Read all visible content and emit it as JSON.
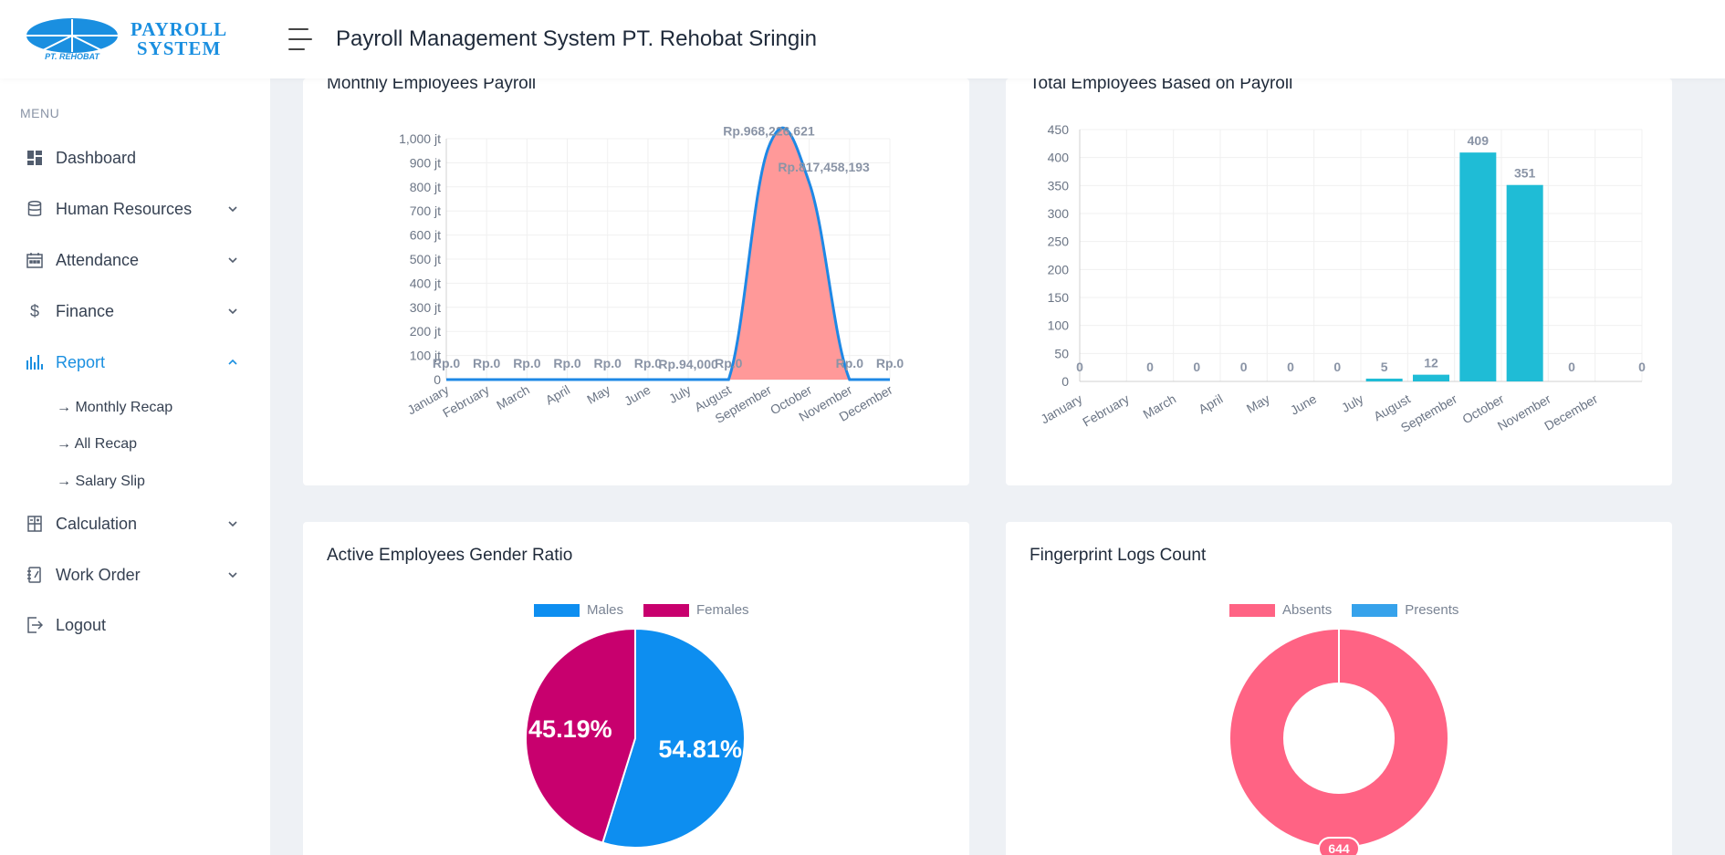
{
  "header": {
    "logo_line1": "PAYROLL",
    "logo_line2": "SYSTEM",
    "logo_arc_text": "PT. REHOBAT",
    "title": "Payroll Management System PT. Rehobat Sringin"
  },
  "sidebar": {
    "heading": "MENU",
    "items": [
      {
        "label": "Dashboard",
        "icon": "dashboard-icon",
        "chevron": ""
      },
      {
        "label": "Human Resources",
        "icon": "database-icon",
        "chevron": "down"
      },
      {
        "label": "Attendance",
        "icon": "calendar-icon",
        "chevron": "down"
      },
      {
        "label": "Finance",
        "icon": "dollar-icon",
        "chevron": "down"
      },
      {
        "label": "Report",
        "icon": "bar-chart-icon",
        "chevron": "up"
      },
      {
        "label": "Calculation",
        "icon": "calculator-icon",
        "chevron": "down"
      },
      {
        "label": "Work Order",
        "icon": "notebook-icon",
        "chevron": "down"
      },
      {
        "label": "Logout",
        "icon": "logout-icon",
        "chevron": ""
      }
    ],
    "report_sub_items": [
      "→ Monthly Recap",
      "→ All Recap",
      "→ Salary Slip"
    ]
  },
  "colors": {
    "accent": "#1a8fe0",
    "payroll_fill": "#ff9999",
    "payroll_line": "#1e88e5",
    "bar": "#1fbcd6",
    "males": "#0d8ef0",
    "females": "#c8006e",
    "absents": "#ff6384",
    "presents": "#36a2eb"
  },
  "cards": {
    "payroll": {
      "title": "Monthly Employees Payroll"
    },
    "employees": {
      "title": "Total Employees Based on Payroll"
    },
    "gender": {
      "title": "Active Employees Gender Ratio"
    },
    "fingerprint": {
      "title": "Fingerprint Logs Count"
    }
  },
  "chart_data": [
    {
      "id": "payroll",
      "type": "area",
      "categories": [
        "January",
        "February",
        "March",
        "April",
        "May",
        "June",
        "July",
        "August",
        "September",
        "October",
        "November",
        "December"
      ],
      "values": [
        0,
        0,
        0,
        0,
        0,
        0,
        94000,
        0,
        968226621,
        817458193,
        0,
        0
      ],
      "data_labels": [
        "Rp.0",
        "Rp.0",
        "Rp.0",
        "Rp.0",
        "Rp.0",
        "Rp.0",
        "Rp.94,000",
        "Rp.0",
        "Rp.968,226,621",
        "Rp.817,458,193",
        "Rp.0",
        "Rp.0"
      ],
      "y_ticks": [
        "0",
        "100 jt",
        "200 jt",
        "300 jt",
        "400 jt",
        "500 jt",
        "600 jt",
        "700 jt",
        "800 jt",
        "900 jt",
        "1,000 jt"
      ],
      "ylim": [
        0,
        1000000000
      ],
      "title": "Monthly Employees Payroll",
      "grid": true
    },
    {
      "id": "employees",
      "type": "bar",
      "categories": [
        "January",
        "February",
        "March",
        "April",
        "May",
        "June",
        "July",
        "August",
        "September",
        "October",
        "November",
        "December"
      ],
      "values": [
        0,
        0,
        0,
        0,
        0,
        0,
        5,
        12,
        409,
        351,
        0,
        0
      ],
      "y_ticks": [
        0,
        50,
        100,
        150,
        200,
        250,
        300,
        350,
        400,
        450
      ],
      "ylim": [
        0,
        450
      ],
      "title": "Total Employees Based on Payroll",
      "grid": true
    },
    {
      "id": "gender",
      "type": "pie",
      "labels": [
        "Males",
        "Females"
      ],
      "values": [
        54.81,
        45.19
      ],
      "value_labels": [
        "54.81%",
        "45.19%"
      ],
      "title": "Active Employees Gender Ratio",
      "legend": "top"
    },
    {
      "id": "fingerprint",
      "type": "pie",
      "donut": true,
      "labels": [
        "Absents",
        "Presents"
      ],
      "values": [
        644,
        0
      ],
      "value_labels": [
        "644"
      ],
      "title": "Fingerprint Logs Count",
      "legend": "top"
    }
  ]
}
